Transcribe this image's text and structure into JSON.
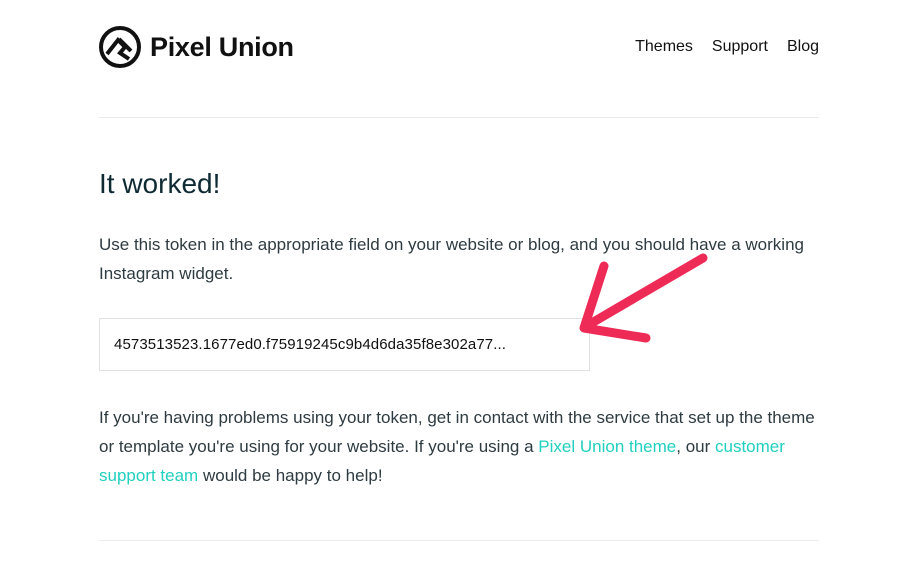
{
  "header": {
    "brand": "Pixel Union",
    "nav": [
      "Themes",
      "Support",
      "Blog"
    ]
  },
  "main": {
    "title": "It worked!",
    "intro": "Use this token in the appropriate field on your website or blog, and you should have a working Instagram widget.",
    "token": "4573513523.1677ed0.f75919245c9b4d6da35f8e302a77...",
    "help": {
      "text1": "If you're having problems using your token, get in contact with the service that set up the theme or template you're using for your website. If you're using a ",
      "link1": "Pixel Union theme",
      "text2": ", our ",
      "link2": "customer support team",
      "text3": " would be happy to help!"
    }
  },
  "colors": {
    "link": "#21d0bf",
    "annotation_arrow": "#ee2a57",
    "text": "#2e3b40"
  },
  "icons": {
    "logo": "pixel-union-logo-icon",
    "arrow": "red-arrow-annotation-icon"
  }
}
